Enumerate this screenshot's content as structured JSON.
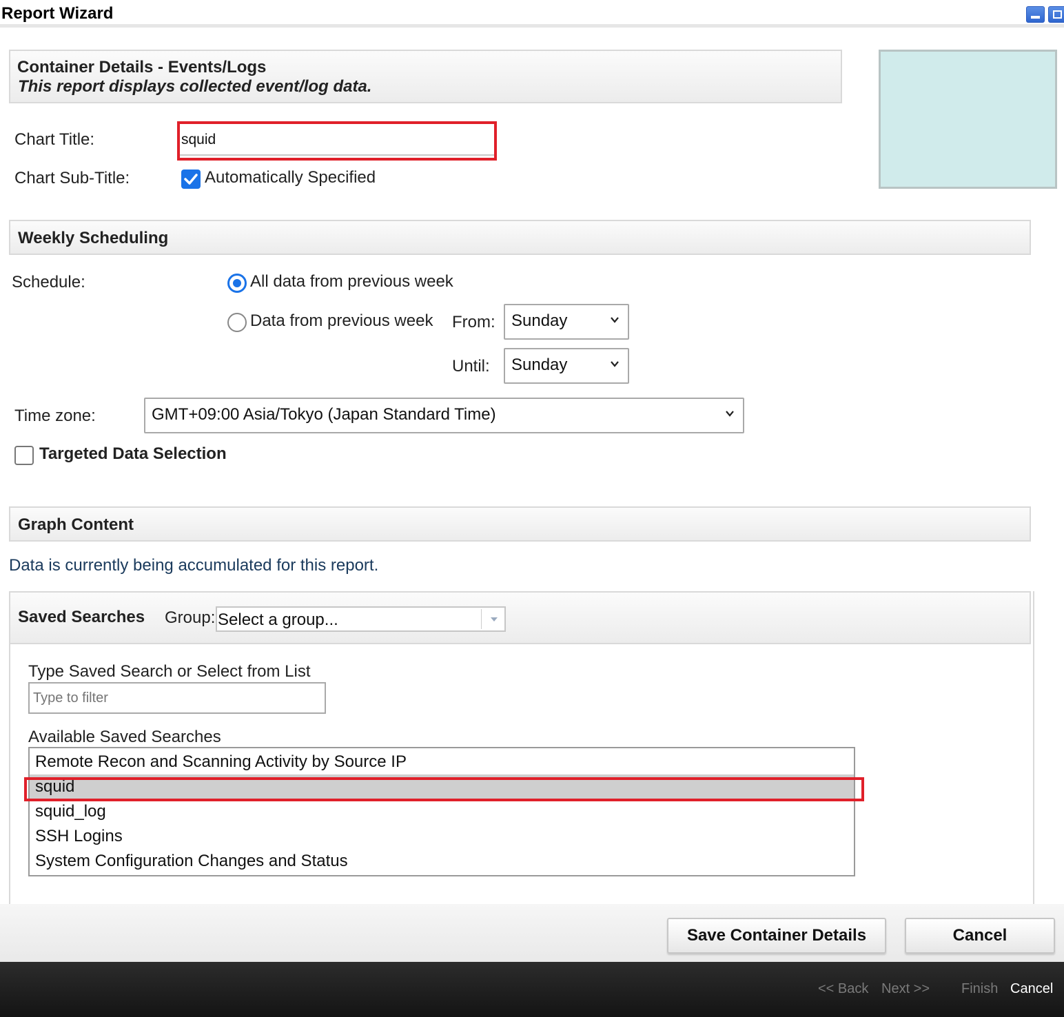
{
  "window": {
    "title": "Report Wizard"
  },
  "container": {
    "heading": "Container Details - Events/Logs",
    "description": "This report displays collected event/log data.",
    "chart_title_label": "Chart Title:",
    "chart_title_value": "squid",
    "chart_subtitle_label": "Chart Sub-Title:",
    "auto_specified_label": "Automatically Specified",
    "auto_specified_checked": true
  },
  "weekly": {
    "heading": "Weekly Scheduling",
    "schedule_label": "Schedule:",
    "option_all": "All data from previous week",
    "option_range": "Data from previous week",
    "from_label": "From:",
    "from_value": "Sunday",
    "until_label": "Until:",
    "until_value": "Sunday",
    "timezone_label": "Time zone:",
    "timezone_value": "GMT+09:00 Asia/Tokyo (Japan Standard Time)",
    "targeted_label": "Targeted Data Selection"
  },
  "graph": {
    "heading": "Graph Content",
    "status": "Data is currently being accumulated for this report."
  },
  "saved": {
    "heading": "Saved Searches",
    "group_label": "Group:",
    "group_placeholder": "Select a group...",
    "filter_label": "Type Saved Search or Select from List",
    "filter_placeholder": "Type to filter",
    "available_label": "Available Saved Searches",
    "items": [
      "Remote Recon and Scanning Activity by Source IP",
      "squid",
      "squid_log",
      "SSH Logins",
      "System Configuration Changes and Status"
    ],
    "selected_item": "squid"
  },
  "actions": {
    "save_label": "Save Container Details",
    "cancel_label": "Cancel"
  },
  "wizard_nav": {
    "back": "<< Back",
    "next": "Next >>",
    "finish": "Finish",
    "cancel": "Cancel"
  },
  "colors": {
    "accent": "#1a73e8",
    "highlight": "#e0202a",
    "preview": "#d0ebeb",
    "status_text": "#1a3a5c",
    "footer_bg": "#1c1c1c"
  }
}
